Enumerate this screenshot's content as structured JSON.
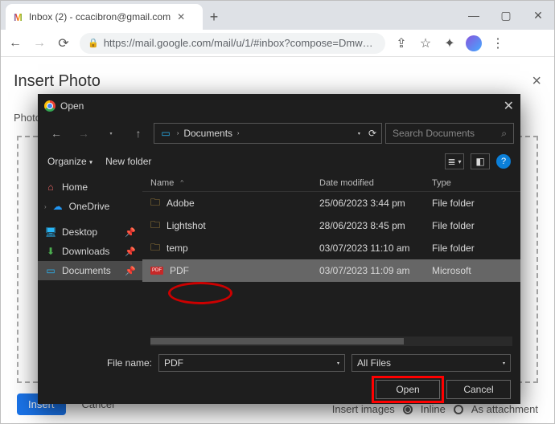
{
  "browser": {
    "tab_title": "Inbox (2) - ccacibron@gmail.com",
    "url": "https://mail.google.com/mail/u/1/#inbox?compose=Dmw…"
  },
  "gmail_modal": {
    "title": "Insert Photo",
    "tab_photos": "Photos",
    "insert_label": "Insert",
    "cancel_label": "Cancel",
    "insert_images": "Insert images",
    "inline_label": "Inline",
    "attachment_label": "As attachment"
  },
  "dialog": {
    "title": "Open",
    "path_root": "Documents",
    "search_placeholder": "Search Documents",
    "organize_label": "Organize",
    "newfolder_label": "New folder",
    "nav": {
      "home": "Home",
      "onedrive": "OneDrive",
      "desktop": "Desktop",
      "downloads": "Downloads",
      "documents": "Documents"
    },
    "columns": {
      "name": "Name",
      "modified": "Date modified",
      "type": "Type"
    },
    "rows": [
      {
        "name": "Adobe",
        "modified": "25/06/2023 3:44 pm",
        "type": "File folder",
        "kind": "folder"
      },
      {
        "name": "Lightshot",
        "modified": "28/06/2023 8:45 pm",
        "type": "File folder",
        "kind": "folder"
      },
      {
        "name": "temp",
        "modified": "03/07/2023 11:10 am",
        "type": "File folder",
        "kind": "folder"
      },
      {
        "name": "PDF",
        "modified": "03/07/2023 11:09 am",
        "type": "Microsoft",
        "kind": "pdf"
      }
    ],
    "filename_label": "File name:",
    "filename_value": "PDF",
    "filetype_value": "All Files",
    "open_label": "Open",
    "cancel_label": "Cancel"
  }
}
